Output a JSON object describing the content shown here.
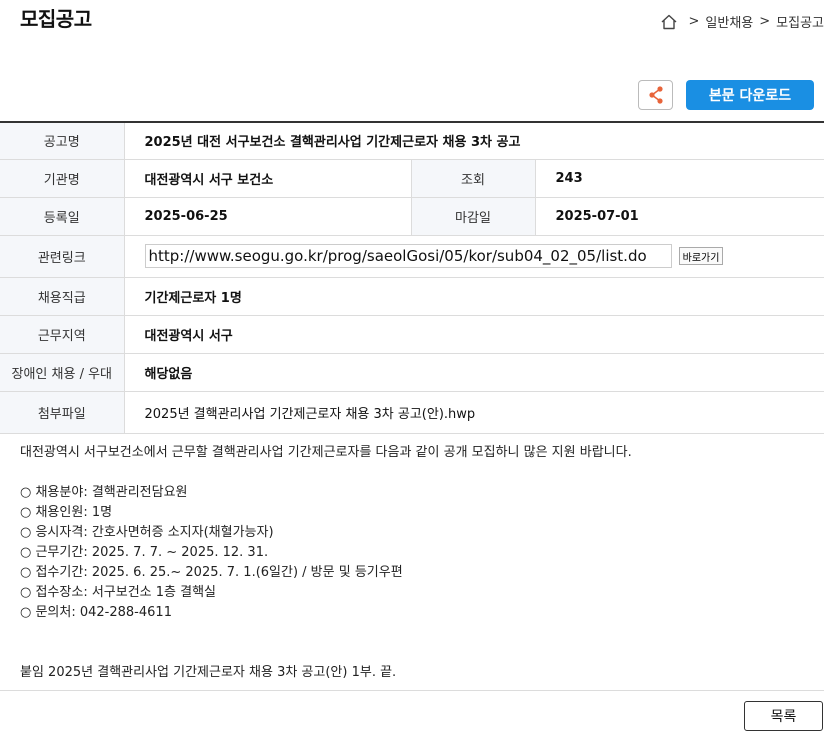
{
  "page": {
    "title": "모집공고"
  },
  "breadcrumb": {
    "items": [
      "일반채용",
      "모집공고"
    ],
    "separator": ">"
  },
  "actions": {
    "download_label": "본문 다운로드"
  },
  "notice": {
    "title_label": "공고명",
    "title": "2025년 대전 서구보건소 결핵관리사업 기간제근로자 채용 3차 공고",
    "org_label": "기관명",
    "org": "대전광역시 서구 보건소",
    "views_label": "조회",
    "views": "243",
    "reg_date_label": "등록일",
    "reg_date": "2025-06-25",
    "deadline_label": "마감일",
    "deadline": "2025-07-01",
    "link_label": "관련링크",
    "link": "http://www.seogu.go.kr/prog/saeolGosi/05/kor/sub04_02_05/list.do",
    "goto_label": "바로가기",
    "position_label": "채용직급",
    "position": "기간제근로자 1명",
    "region_label": "근무지역",
    "region": "대전광역시 서구",
    "disabled_label": "장애인 채용 / 우대",
    "disabled": "해당없음",
    "attachment_label": "첨부파일",
    "attachment": "2025년 결핵관리사업 기간제근로자 채용 3차 공고(안).hwp"
  },
  "content": {
    "intro": "대전광역시 서구보건소에서 근무할 결핵관리사업 기간제근로자를 다음과 같이 공개 모집하니 많은 지원 바랍니다.",
    "items": [
      "○ 채용분야: 결핵관리전담요원",
      "○ 채용인원: 1명",
      "○ 응시자격: 간호사면허증 소지자(채혈가능자)",
      "○ 근무기간: 2025. 7. 7. ~ 2025. 12. 31.",
      "○ 접수기간: 2025. 6. 25.~ 2025. 7. 1.(6일간) / 방문 및 등기우편",
      "○ 접수장소: 서구보건소 1층 결핵실",
      "○ 문의처: 042-288-4611"
    ],
    "closing": "붙임  2025년 결핵관리사업 기간제근로자 채용 3차 공고(안) 1부.  끝."
  },
  "footer": {
    "list_label": "목록"
  },
  "colors": {
    "accent": "#1a8fe3",
    "share_icon": "#e8643a"
  },
  "icons": {
    "home": "home-icon",
    "share": "share-icon"
  }
}
